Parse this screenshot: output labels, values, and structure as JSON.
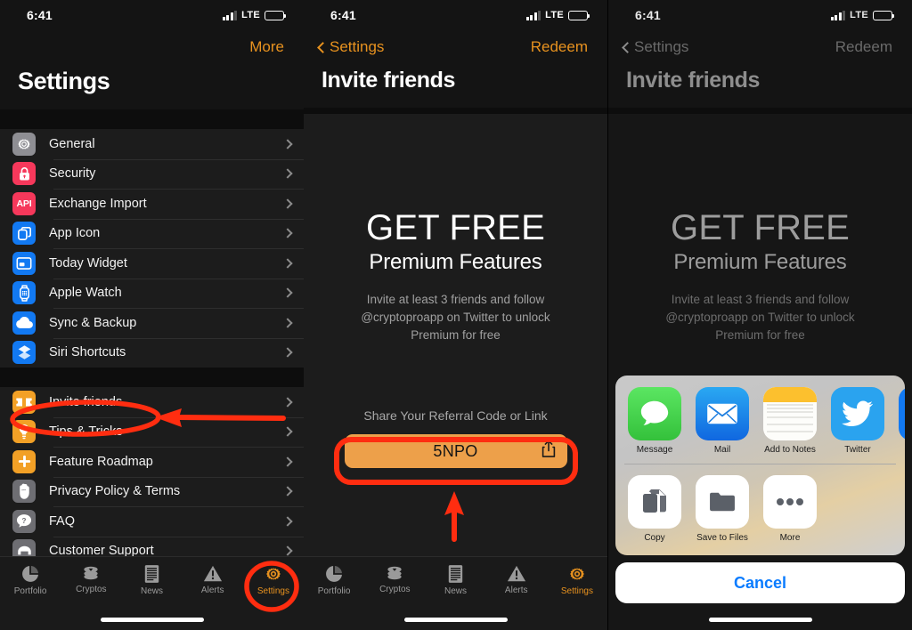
{
  "status_bar": {
    "time": "6:41",
    "network": "LTE",
    "signal_icon": "cellular-bars-icon",
    "battery_icon": "battery-icon"
  },
  "panel1": {
    "nav": {
      "right_label": "More"
    },
    "title": "Settings",
    "group1": [
      {
        "label": "General",
        "icon": "gear-icon",
        "color": "#8E8E93"
      },
      {
        "label": "Security",
        "icon": "lock-icon",
        "color": "#F6385B"
      },
      {
        "label": "Exchange Import",
        "icon": "api-icon",
        "color": "#F6385B",
        "text": "API"
      },
      {
        "label": "App Icon",
        "icon": "app-icon-icon",
        "color": "#1279F2"
      },
      {
        "label": "Today Widget",
        "icon": "widget-icon",
        "color": "#1279F2"
      },
      {
        "label": "Apple Watch",
        "icon": "apple-watch-icon",
        "color": "#1279F2"
      },
      {
        "label": "Sync & Backup",
        "icon": "cloud-icon",
        "color": "#1279F2"
      },
      {
        "label": "Siri Shortcuts",
        "icon": "siri-shortcuts-icon",
        "color": "#1279F2"
      }
    ],
    "group2": [
      {
        "label": "Invite friends",
        "icon": "ticket-icon",
        "color": "#F2A026",
        "highlighted": true
      },
      {
        "label": "Tips & Tricks",
        "icon": "lightbulb-icon",
        "color": "#F2A026"
      },
      {
        "label": "Feature Roadmap",
        "icon": "plus-icon",
        "color": "#F2A026"
      },
      {
        "label": "Privacy Policy & Terms",
        "icon": "hand-raised-icon",
        "color": "#6E6E73"
      },
      {
        "label": "FAQ",
        "icon": "question-bubble-icon",
        "color": "#6E6E73"
      },
      {
        "label": "Customer Support",
        "icon": "support-icon",
        "color": "#6E6E73"
      }
    ]
  },
  "panel2": {
    "nav": {
      "back_label": "Settings",
      "right_label": "Redeem"
    },
    "title": "Invite friends",
    "hero_title": "GET FREE",
    "hero_subtitle": "Premium Features",
    "description": "Invite at least 3 friends and follow @cryptoproapp on Twitter to unlock Premium for free",
    "share_label": "Share Your Referral Code or Link",
    "referral_code": "5NPO",
    "share_icon": "share-up-arrow-icon"
  },
  "panel3": {
    "nav": {
      "back_label": "Settings",
      "right_label": "Redeem"
    },
    "title": "Invite friends",
    "hero_title": "GET FREE",
    "hero_subtitle": "Premium Features",
    "description": "Invite at least 3 friends and follow @cryptoproapp on Twitter to unlock Premium for free",
    "share_sheet": {
      "apps": [
        {
          "label": "Message",
          "icon": "messages-app-icon"
        },
        {
          "label": "Mail",
          "icon": "mail-app-icon"
        },
        {
          "label": "Add to Notes",
          "icon": "notes-app-icon"
        },
        {
          "label": "Twitter",
          "icon": "twitter-app-icon"
        },
        {
          "label": "",
          "icon": "partial-app-icon"
        }
      ],
      "actions": [
        {
          "label": "Copy",
          "icon": "copy-icon"
        },
        {
          "label": "Save to Files",
          "icon": "folder-icon"
        },
        {
          "label": "More",
          "icon": "ellipsis-icon"
        }
      ],
      "cancel_label": "Cancel"
    }
  },
  "tabbar": {
    "tabs": [
      {
        "label": "Portfolio",
        "icon": "pie-chart-icon",
        "active": false
      },
      {
        "label": "Cryptos",
        "icon": "coins-icon",
        "active": false
      },
      {
        "label": "News",
        "icon": "news-document-icon",
        "active": false
      },
      {
        "label": "Alerts",
        "icon": "alert-triangle-icon",
        "active": false
      },
      {
        "label": "Settings",
        "icon": "gear-icon",
        "active": true
      }
    ]
  },
  "colors": {
    "accent": "#E8921F",
    "annotation": "#FF2D10",
    "referral_button": "#EDA04A",
    "cancel_blue": "#0A7CFF"
  },
  "annotations": {
    "invite_row_circle": "red-ellipse-highlight",
    "invite_row_arrow": "red-left-arrow",
    "settings_tab_circle": "red-ellipse-highlight",
    "code_button_rect": "red-rounded-rect-highlight",
    "code_button_arrow": "red-up-arrow"
  }
}
